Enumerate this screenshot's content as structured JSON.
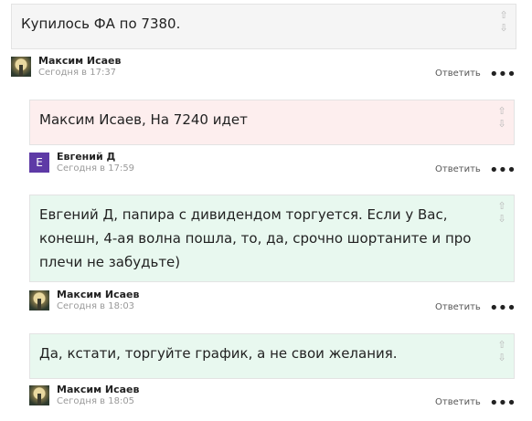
{
  "comments": [
    {
      "text": "Купилось ФА по 7380.",
      "bg": "#f5f5f5",
      "author": "Максим Исаев",
      "date": "Сегодня в 17:37",
      "avatar": "photo"
    },
    {
      "text": "Максим Исаев, На 7240 идет",
      "bg": "#fdeeee",
      "author": "Евгений Д",
      "date": "Сегодня в 17:59",
      "avatar": "letter",
      "avatar_letter": "Е",
      "avatar_color": "#5e3aa6"
    },
    {
      "text": "Евгений Д, папира с дивидендом торгуется. Если у Вас, конешн, 4-ая волна пошла, то, да, срочно шортаните и про плечи не забудьте)",
      "bg": "#e8f8ef",
      "author": "Максим Исаев",
      "date": "Сегодня в 18:03",
      "avatar": "photo"
    },
    {
      "text": "Да, кстати, торгуйте график, а не свои желания.",
      "bg": "#e8f8ef",
      "author": "Максим Исаев",
      "date": "Сегодня в 18:05",
      "avatar": "photo"
    }
  ],
  "actions": {
    "reply_label": "Ответить",
    "more_label": "•••",
    "upvote_icon": "⇧",
    "downvote_icon": "⇩"
  }
}
